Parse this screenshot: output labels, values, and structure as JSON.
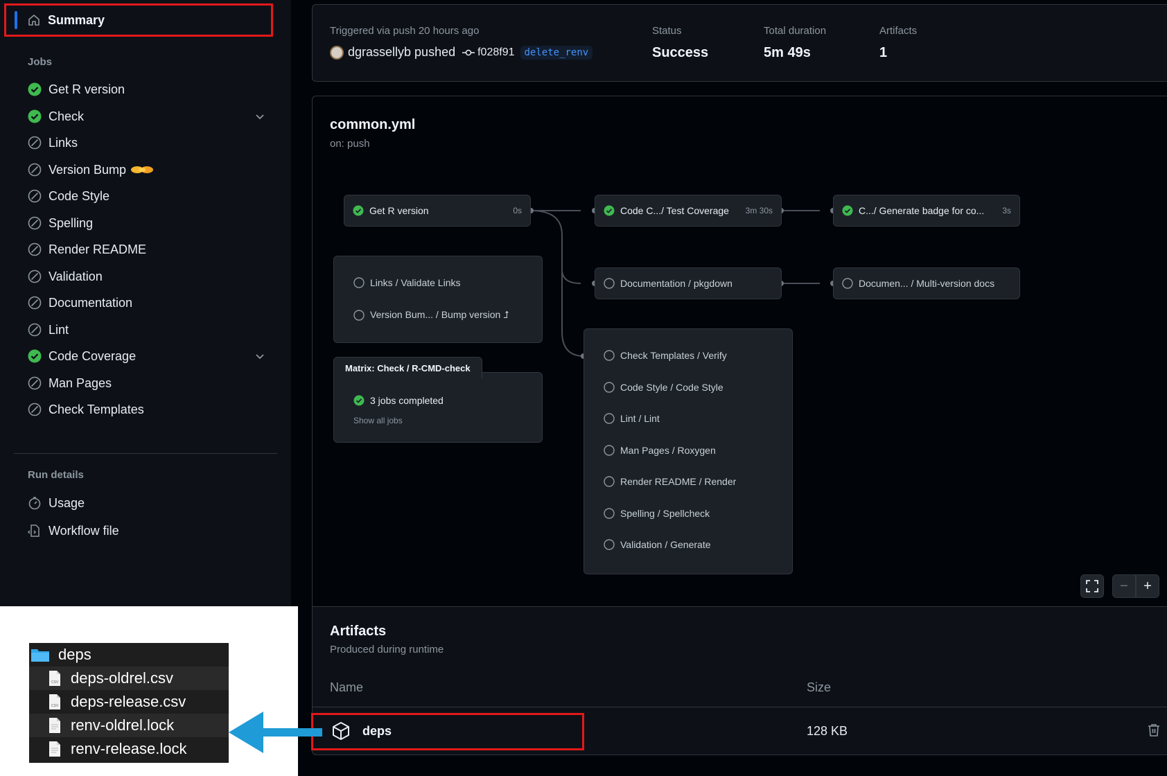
{
  "sidebar": {
    "summary_label": "Summary",
    "jobs_heading": "Jobs",
    "jobs": [
      {
        "label": "Get R version",
        "status": "success"
      },
      {
        "label": "Check",
        "status": "success",
        "expandable": true
      },
      {
        "label": "Links",
        "status": "skipped"
      },
      {
        "label": "Version Bump",
        "status": "skipped",
        "emoji": "handshake"
      },
      {
        "label": "Code Style",
        "status": "skipped"
      },
      {
        "label": "Spelling",
        "status": "skipped"
      },
      {
        "label": "Render README",
        "status": "skipped"
      },
      {
        "label": "Validation",
        "status": "skipped"
      },
      {
        "label": "Documentation",
        "status": "skipped"
      },
      {
        "label": "Lint",
        "status": "skipped"
      },
      {
        "label": "Code Coverage",
        "status": "success",
        "expandable": true
      },
      {
        "label": "Man Pages",
        "status": "skipped"
      },
      {
        "label": "Check Templates",
        "status": "skipped"
      }
    ],
    "run_details_heading": "Run details",
    "run_details": [
      {
        "label": "Usage",
        "icon": "stopwatch-icon"
      },
      {
        "label": "Workflow file",
        "icon": "file-code-icon"
      }
    ]
  },
  "run_info": {
    "triggered": "Triggered via push 20 hours ago",
    "actor": "dgrassellyb pushed",
    "commit_sha": "f028f91",
    "branch": "delete_renv",
    "status_label": "Status",
    "status_value": "Success",
    "duration_label": "Total duration",
    "duration_value": "5m 49s",
    "artifacts_label": "Artifacts",
    "artifacts_value": "1"
  },
  "workflow": {
    "file": "common.yml",
    "trigger": "on: push",
    "nodes": {
      "get_r_version": {
        "label": "Get R version",
        "duration": "0s"
      },
      "code_coverage": {
        "label": "Code C.../ Test Coverage",
        "duration": "3m 30s"
      },
      "badge": {
        "label": "C.../ Generate badge for co...",
        "duration": "3s"
      },
      "pkgdown": {
        "label": "Documentation / pkgdown"
      },
      "multiversion": {
        "label": "Documen... / Multi-version docs"
      }
    },
    "group_links": [
      "Links / Validate Links",
      "Version Bum... / Bump version ⮥"
    ],
    "matrix": {
      "title": "Matrix: Check / R-CMD-check",
      "completed": "3 jobs completed",
      "show_all": "Show all jobs"
    },
    "group_checks": [
      "Check Templates / Verify",
      "Code Style / Code Style",
      "Lint / Lint",
      "Man Pages / Roxygen",
      "Render README / Render",
      "Spelling / Spellcheck",
      "Validation / Generate"
    ],
    "zoom": {
      "fullscreen": "fullscreen-icon",
      "minus": "−",
      "plus": "+"
    }
  },
  "artifacts": {
    "title": "Artifacts",
    "subtitle": "Produced during runtime",
    "col_name": "Name",
    "col_size": "Size",
    "rows": [
      {
        "name": "deps",
        "size": "128 KB"
      }
    ]
  },
  "finder": {
    "folder": "deps",
    "files": [
      "deps-oldrel.csv",
      "deps-release.csv",
      "renv-oldrel.lock",
      "renv-release.lock"
    ]
  },
  "colors": {
    "success": "#3fb950",
    "highlight": "#e3181a",
    "arrow": "#1f9bd7",
    "accent": "#1f6feb"
  }
}
